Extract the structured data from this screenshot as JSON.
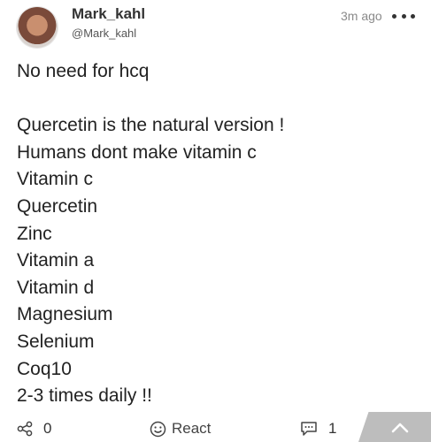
{
  "post": {
    "author": {
      "display_name": "Mark_kahl",
      "handle": "@Mark_kahl"
    },
    "timestamp": "3m ago",
    "more_icon": "more-horizontal-icon",
    "body_lines": [
      "No need for hcq",
      "",
      "Quercetin is the natural version !",
      "Humans dont make vitamin c",
      "Vitamin c",
      "Quercetin",
      "Zinc",
      "Vitamin a",
      "Vitamin d",
      "Magnesium",
      "Selenium",
      "Coq10",
      "2-3 times daily  !!"
    ]
  },
  "actions": {
    "share_count": "0",
    "react_label": "React",
    "comment_count": "1",
    "share_icon": "share-icon",
    "react_icon": "smiley-icon",
    "comment_icon": "comment-icon",
    "scroll_top_icon": "chevron-up-icon"
  },
  "colors": {
    "text": "#222222",
    "muted": "#8a8a8a",
    "scroll_tab": "#bdbdbd"
  }
}
